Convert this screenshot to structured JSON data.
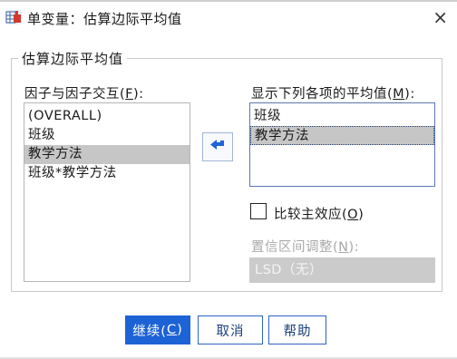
{
  "window": {
    "title": "单变量：估算边际平均值",
    "close_glyph": "×"
  },
  "group": {
    "legend": "估算边际平均值"
  },
  "factors": {
    "label_pre": "因子与因子交互(",
    "label_key": "F",
    "label_post": "):",
    "items": [
      "(OVERALL)",
      "班级",
      "教学方法",
      "班级*教学方法"
    ],
    "selected_index": 2
  },
  "means": {
    "label_pre": "显示下列各项的平均值(",
    "label_key": "M",
    "label_post": "):",
    "items": [
      "班级",
      "教学方法"
    ],
    "selected_index": 1
  },
  "compare": {
    "label_pre": "比较主效应(",
    "label_key": "O",
    "label_post": ")",
    "checked": false
  },
  "ci": {
    "label_pre": "置信区间调整(",
    "label_key": "N",
    "label_post": "):",
    "value": "LSD（无）"
  },
  "buttons": {
    "continue_pre": "继续(",
    "continue_key": "C",
    "continue_post": ")",
    "cancel": "取消",
    "help": "帮助"
  },
  "colors": {
    "primary": "#1d63d6",
    "selection": "#c6c6c6",
    "arrow": "#1d63d6"
  },
  "icons": {
    "app": "spss-table-icon",
    "move": "arrow-left-icon",
    "close": "close-icon"
  }
}
